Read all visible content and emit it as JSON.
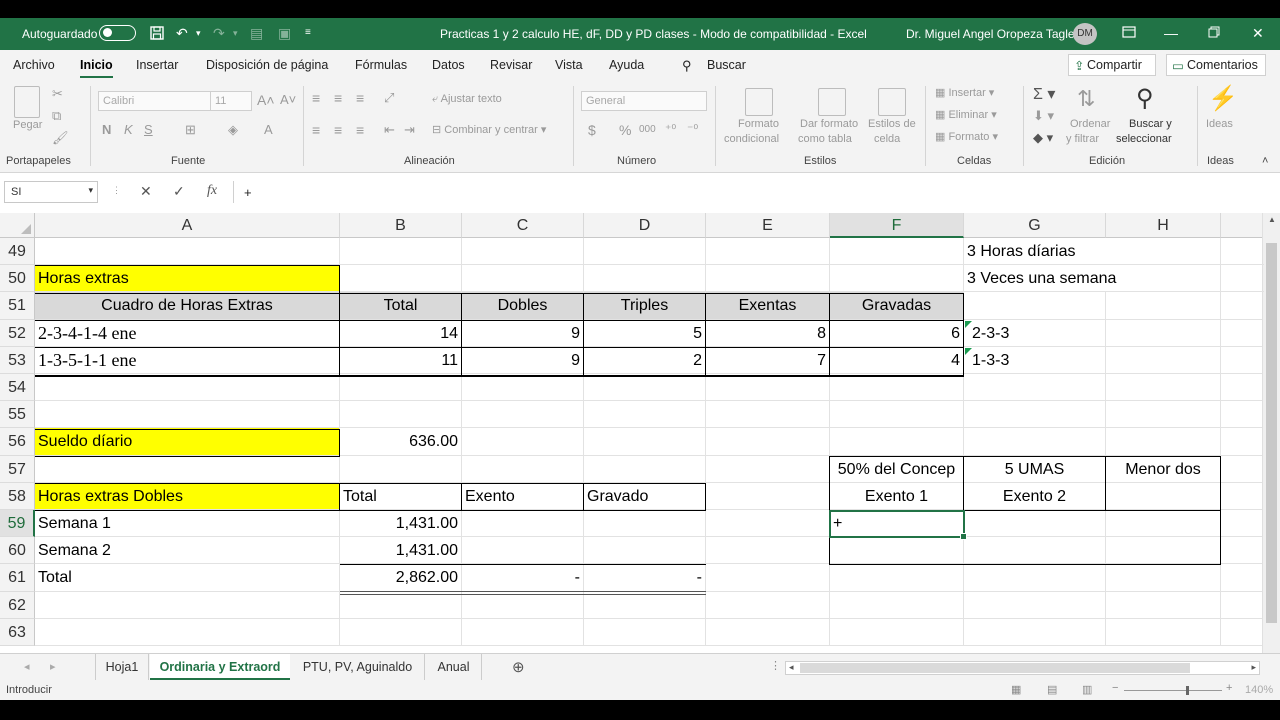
{
  "title_bar": {
    "autosave_label": "Autoguardado",
    "document_title": "Practicas 1 y 2 calculo HE, dF, DD y PD clases  -  Modo de compatibilidad  -  Excel",
    "user_name": "Dr. Miguel Angel Oropeza Tagle",
    "user_initials": "DM"
  },
  "menu": {
    "items": [
      "Archivo",
      "Inicio",
      "Insertar",
      "Disposición de página",
      "Fórmulas",
      "Datos",
      "Revisar",
      "Vista",
      "Ayuda"
    ],
    "active": "Inicio",
    "search_placeholder": "Buscar",
    "share_label": "Compartir",
    "comments_label": "Comentarios"
  },
  "ribbon": {
    "paste_label": "Pegar",
    "font_name": "Calibri",
    "font_size": "11",
    "bold": "N",
    "italic": "K",
    "underline": "S",
    "wrap_text": "Ajustar texto",
    "merge_center": "Combinar y centrar",
    "number_format": "General",
    "currency": "$",
    "percent": "%",
    "thousands": "000",
    "conditional_format": [
      "Formato",
      "condicional"
    ],
    "format_as_table": [
      "Dar formato",
      "como tabla"
    ],
    "cell_styles": [
      "Estilos de",
      "celda"
    ],
    "insert": "Insertar",
    "delete": "Eliminar",
    "format": "Formato",
    "sort_filter": [
      "Ordenar",
      "y filtrar"
    ],
    "find_select": [
      "Buscar y",
      "seleccionar"
    ],
    "ideas": "Ideas",
    "groups": [
      "Portapapeles",
      "Fuente",
      "Alineación",
      "Número",
      "Estilos",
      "Celdas",
      "Edición",
      "Ideas"
    ]
  },
  "formula_bar": {
    "name_box": "SI",
    "formula": "+"
  },
  "sheet": {
    "columns": [
      "A",
      "B",
      "C",
      "D",
      "E",
      "F",
      "G",
      "H"
    ],
    "selected_column": "F",
    "rows": [
      "49",
      "50",
      "51",
      "52",
      "53",
      "54",
      "55",
      "56",
      "57",
      "58",
      "59",
      "60",
      "61",
      "62",
      "63"
    ],
    "selected_row": "59",
    "cells": {
      "G49": "3 Horas díarias",
      "A50": "Horas extras",
      "G50": "3 Veces una semana",
      "A51": "Cuadro de Horas Extras",
      "B51": "Total",
      "C51": "Dobles",
      "D51": "Triples",
      "E51": "Exentas",
      "F51": "Gravadas",
      "A52": "2-3-4-1-4 ene",
      "B52": "14",
      "C52": "9",
      "D52": "5",
      "E52": "8",
      "F52": "6",
      "G52": "2-3-3",
      "A53": "1-3-5-1-1 ene",
      "B53": "11",
      "C53": "9",
      "D53": "2",
      "E53": "7",
      "F53": "4",
      "G53": "1-3-3",
      "A56": "Sueldo díario",
      "B56": "636.00",
      "F57": "50% del Concep",
      "G57": "5 UMAS",
      "H57": "Menor dos",
      "A58": "Horas extras Dobles",
      "B58": "Total",
      "C58": "Exento",
      "D58": "Gravado",
      "F58": "Exento 1",
      "G58": "Exento 2",
      "A59": "Semana 1",
      "B59": "1,431.00",
      "F59": "+",
      "A60": "Semana 2",
      "B60": "1,431.00",
      "A61": "Total",
      "B61": "2,862.00",
      "C61": "-",
      "D61": "-"
    }
  },
  "sheet_tabs": {
    "tabs": [
      "Hoja1",
      "Ordinaria y Extraord",
      "PTU, PV, Aguinaldo",
      "Anual"
    ],
    "active": "Ordinaria y Extraord"
  },
  "status_bar": {
    "mode": "Introducir",
    "zoom": "140%"
  },
  "colors": {
    "excel_green": "#217346",
    "highlight_yellow": "#ffff00",
    "header_gray": "#d9d9d9"
  }
}
